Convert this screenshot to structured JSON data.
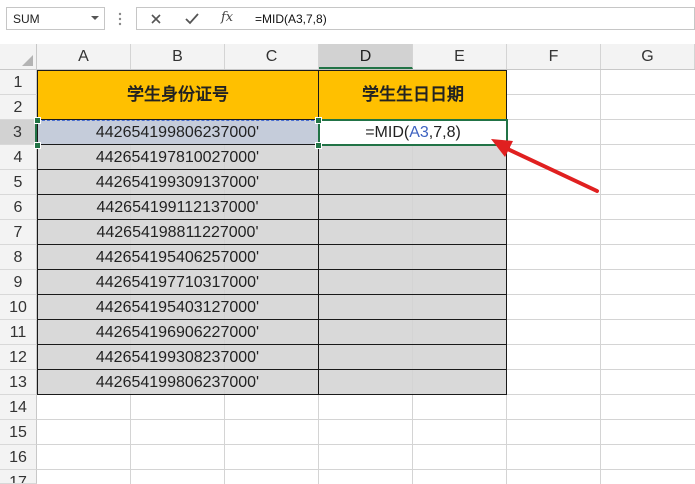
{
  "name_box": {
    "value": "SUM"
  },
  "formula_bar": {
    "cancel_icon": "close-icon",
    "enter_icon": "check-icon",
    "function_icon": "fx-icon",
    "fx_label": "fx",
    "formula": "=MID(A3,7,8)"
  },
  "columns": [
    "A",
    "B",
    "C",
    "D",
    "E",
    "F",
    "G"
  ],
  "rows": [
    "1",
    "2",
    "3",
    "4",
    "5",
    "6",
    "7",
    "8",
    "9",
    "10",
    "11",
    "12",
    "13",
    "14",
    "15",
    "16",
    "17"
  ],
  "header_cells": {
    "id_header": "学生身份证号",
    "birthday_header": "学生生日日期"
  },
  "id_numbers": [
    "442654199806237000'",
    "442654197810027000'",
    "442654199309137000'",
    "442654199112137000'",
    "442654198811227000'",
    "442654195406257000'",
    "442654197710317000'",
    "442654195403127000'",
    "442654196906227000'",
    "442654199308237000'",
    "442654199806237000'"
  ],
  "active_cell": {
    "formula_prefix": "=MID(",
    "formula_ref": "A3",
    "formula_suffix": ",7,8)"
  },
  "colors": {
    "header_fill": "#ffc000",
    "data_fill": "#d9d9d9",
    "selection_green": "#217346",
    "arrow_red": "#e02020",
    "ref_blue": "#3e62c0"
  }
}
